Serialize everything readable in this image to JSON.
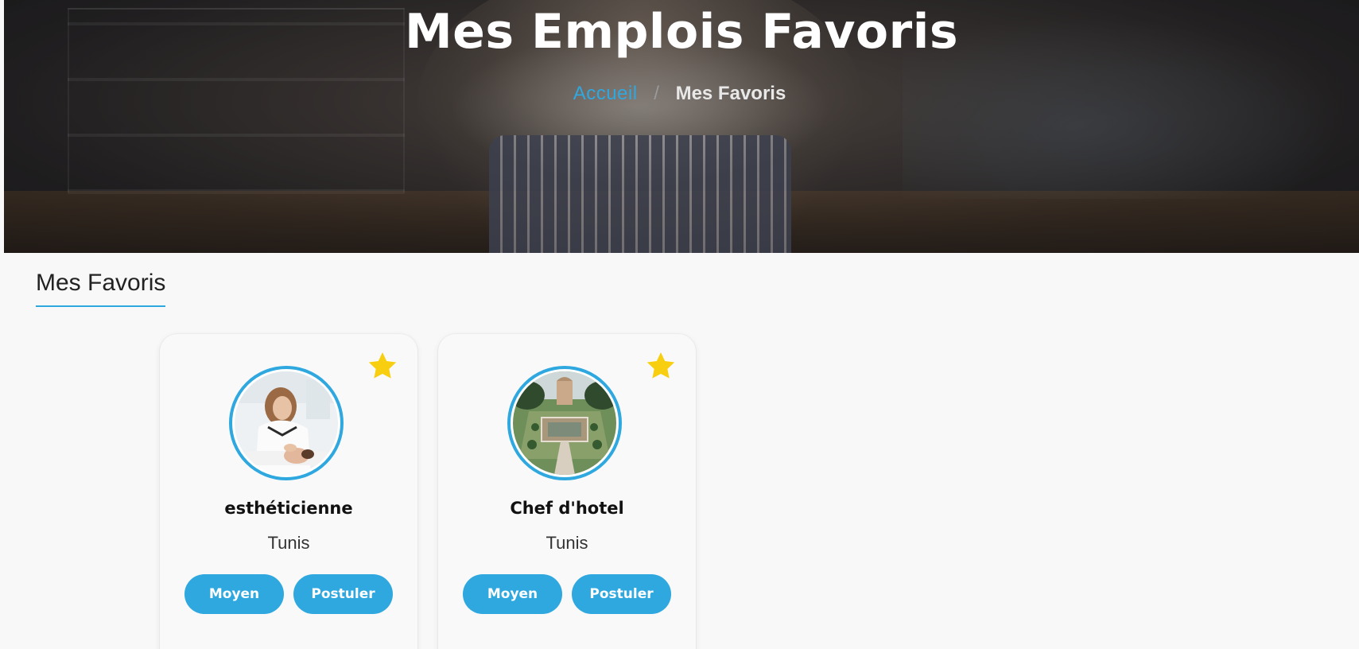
{
  "hero": {
    "title": "Mes Emplois Favoris",
    "breadcrumb": {
      "home": "Accueil",
      "separator": "/",
      "current": "Mes Favoris"
    }
  },
  "section": {
    "title": "Mes Favoris"
  },
  "colors": {
    "accent": "#2fa8e0",
    "star": "#f7cf10"
  },
  "favorites": [
    {
      "title": "esthéticienne",
      "location": "Tunis",
      "level_label": "Moyen",
      "apply_label": "Postuler",
      "favorite_icon": "star-icon",
      "image": "beautician-photo"
    },
    {
      "title": "Chef d'hotel",
      "location": "Tunis",
      "level_label": "Moyen",
      "apply_label": "Postuler",
      "favorite_icon": "star-icon",
      "image": "hotel-garden-photo"
    }
  ]
}
